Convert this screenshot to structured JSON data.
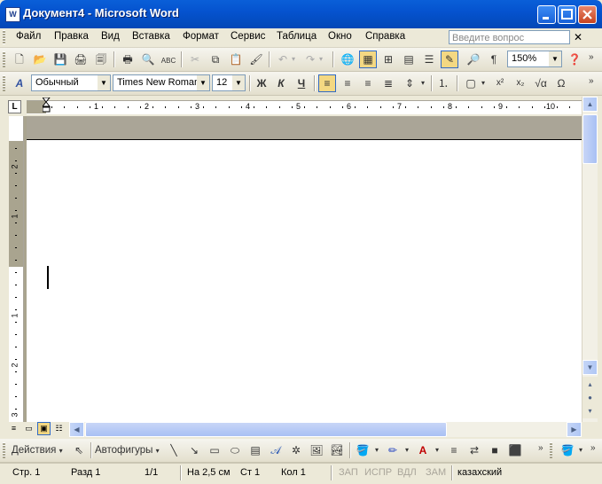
{
  "window": {
    "title": "Документ4 - Microsoft Word",
    "app_icon": "word-doc-icon"
  },
  "menu": {
    "items": [
      "Файл",
      "Правка",
      "Вид",
      "Вставка",
      "Формат",
      "Сервис",
      "Таблица",
      "Окно",
      "Справка"
    ],
    "help_placeholder": "Введите вопрос"
  },
  "standard_toolbar": {
    "zoom": "150%"
  },
  "formatting_toolbar": {
    "style": "Обычный",
    "font": "Times New Roman",
    "size": "12",
    "bold": "Ж",
    "italic": "К",
    "underline": "Ч"
  },
  "ruler": {
    "tab_selector": "L",
    "numbers": [
      "1",
      "2",
      "3",
      "4",
      "5",
      "6",
      "7",
      "8",
      "9",
      "10"
    ],
    "vertical_numbers": [
      "2",
      "1",
      "1",
      "2",
      "3"
    ]
  },
  "drawing_toolbar": {
    "actions_label": "Действия",
    "autoshapes_label": "Автофигуры"
  },
  "status_bar": {
    "page": "Стр. 1",
    "section": "Разд 1",
    "page_of": "1/1",
    "at": "На 2,5 см",
    "line": "Ст 1",
    "column": "Кол 1",
    "rec": "ЗАП",
    "trk": "ИСПР",
    "ext": "ВДЛ",
    "ovr": "ЗАМ",
    "language": "казахский"
  },
  "colors": {
    "titlebar": "#0553cf",
    "chrome": "#ece9d8",
    "page": "#ffffff",
    "margin": "#a9a48f"
  }
}
